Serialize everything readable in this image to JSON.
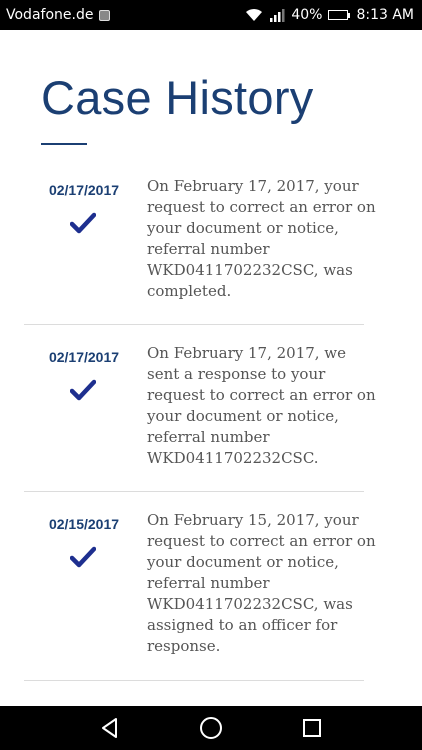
{
  "status_bar": {
    "carrier": "Vodafone.de",
    "notification_icon": "image-icon",
    "battery_percent": "40%",
    "battery_level": 0.4,
    "time": "8:13 AM"
  },
  "page": {
    "title": "Case History",
    "accent_color": "#1b3f73"
  },
  "entries": [
    {
      "date": "02/17/2017",
      "icon": "check-icon",
      "text": "On February 17, 2017, your request to correct an error on your document or notice, referral number WKD0411702232CSC, was completed."
    },
    {
      "date": "02/17/2017",
      "icon": "check-icon",
      "text": "On February 17, 2017, we sent a response to your request to correct an error on your document or notice, referral number WKD0411702232CSC."
    },
    {
      "date": "02/15/2017",
      "icon": "check-icon",
      "text": "On February 15, 2017, your request to correct an error on your document or notice, referral number WKD0411702232CSC, was assigned to an officer for response."
    }
  ],
  "nav_bar": {
    "back": "back-icon",
    "home": "home-icon",
    "recents": "recents-icon"
  }
}
